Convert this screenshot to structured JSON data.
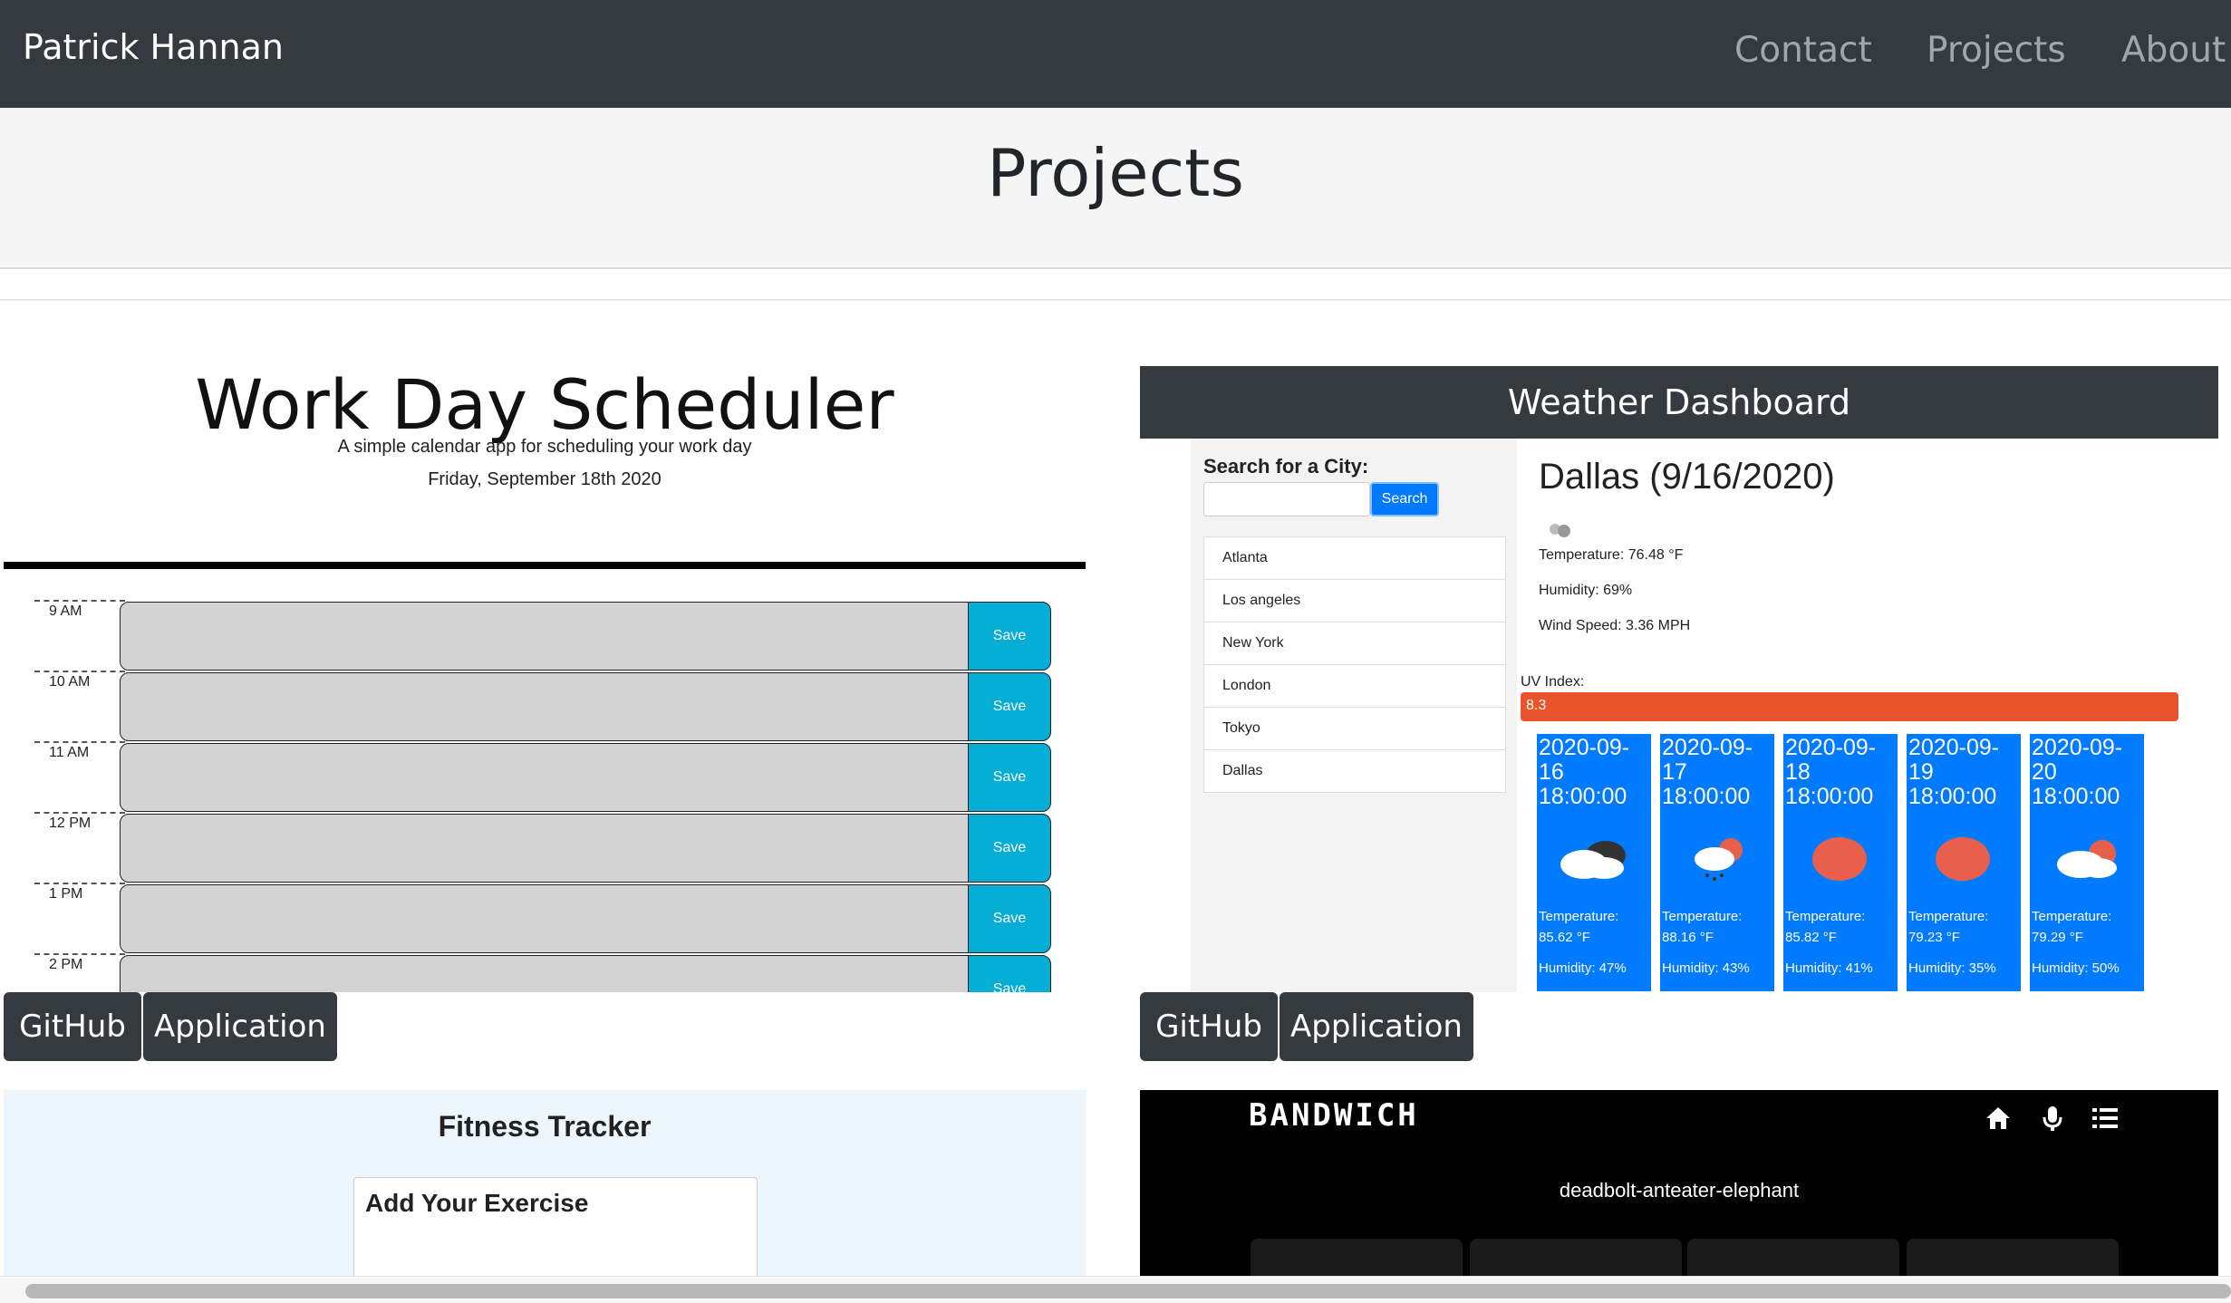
{
  "navbar": {
    "brand": "Patrick Hannan",
    "links": [
      "Contact",
      "Projects",
      "About"
    ]
  },
  "page_title": "Projects",
  "projects": {
    "scheduler": {
      "title": "Work Day Scheduler",
      "subtitle": "A simple calendar app for scheduling your work day",
      "date": "Friday, September 18th 2020",
      "hours": [
        "9 AM",
        "10 AM",
        "11 AM",
        "12 PM",
        "1 PM",
        "2 PM"
      ],
      "save_label": "Save",
      "github_label": "GitHub",
      "application_label": "Application"
    },
    "weather": {
      "header": "Weather Dashboard",
      "search_label": "Search for a City:",
      "search_button": "Search",
      "search_value": "",
      "cities": [
        "Atlanta",
        "Los angeles",
        "New York",
        "London",
        "Tokyo",
        "Dallas"
      ],
      "current": {
        "title": "Dallas (9/16/2020)",
        "temperature": "Temperature: 76.48 °F",
        "humidity": "Humidity: 69%",
        "wind": "Wind Speed: 3.36 MPH",
        "uv_label": "UV Index:",
        "uv_value": "8.3"
      },
      "forecast": [
        {
          "date": "2020-09-\n16\n18:00:00",
          "temp": "Temperature:\n85.62 °F",
          "humidity": "Humidity: 47%",
          "icon": "cloud-dark-icon"
        },
        {
          "date": "2020-09-\n17\n18:00:00",
          "temp": "Temperature:\n88.16 °F",
          "humidity": "Humidity: 43%",
          "icon": "rain-sun-icon"
        },
        {
          "date": "2020-09-\n18\n18:00:00",
          "temp": "Temperature:\n85.82 °F",
          "humidity": "Humidity: 41%",
          "icon": "sun-icon"
        },
        {
          "date": "2020-09-\n19\n18:00:00",
          "temp": "Temperature:\n79.23 °F",
          "humidity": "Humidity: 35%",
          "icon": "sun-icon"
        },
        {
          "date": "2020-09-\n20\n18:00:00",
          "temp": "Temperature:\n79.29 °F",
          "humidity": "Humidity: 50%",
          "icon": "cloud-sun-icon"
        }
      ],
      "github_label": "GitHub",
      "application_label": "Application"
    },
    "fitness": {
      "title": "Fitness Tracker",
      "card_title": "Add Your Exercise"
    },
    "bandwich": {
      "logo": "BANDWICH",
      "words": "deadbolt-anteater-elephant",
      "icons": [
        "home-icon",
        "microphone-icon",
        "list-icon"
      ]
    }
  },
  "colors": {
    "navbar": "#343a40",
    "save_button": "#06aed5",
    "forecast_card": "#007bff",
    "uv_high": "#e9542c"
  }
}
